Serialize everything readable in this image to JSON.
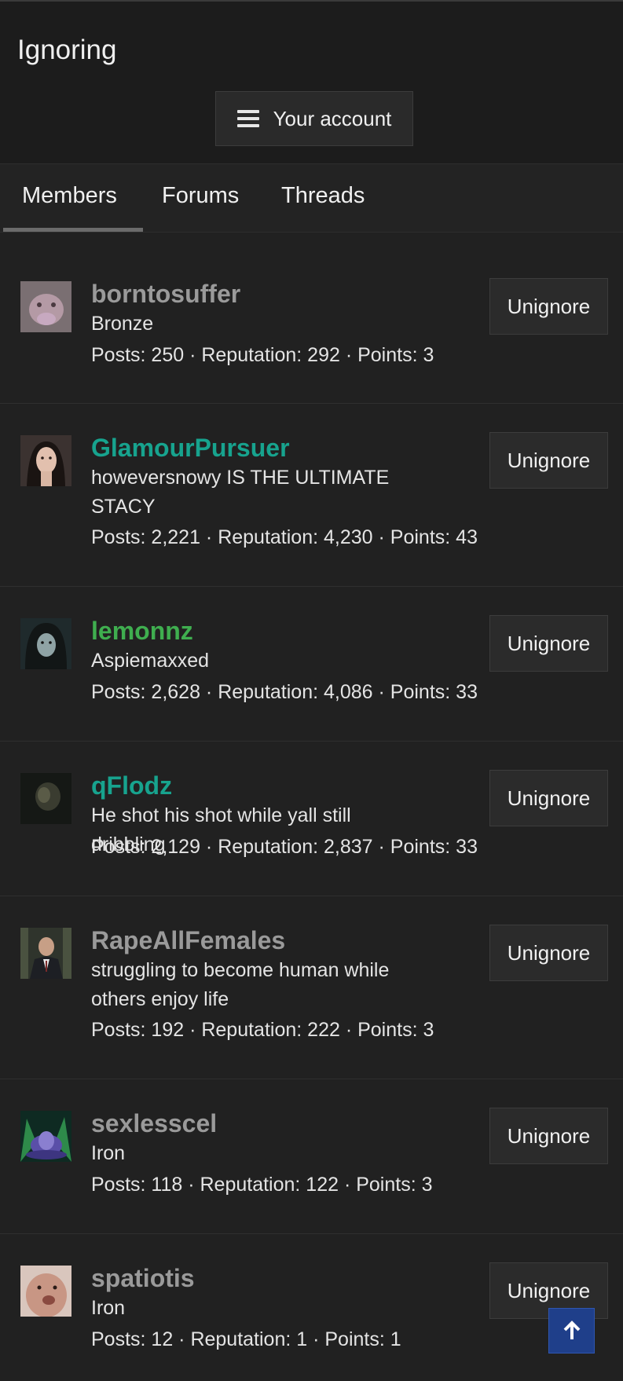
{
  "header": {
    "title": "Ignoring",
    "account_label": "Your account"
  },
  "tabs": [
    {
      "label": "Members"
    },
    {
      "label": "Forums"
    },
    {
      "label": "Threads"
    }
  ],
  "members": [
    {
      "name": "borntosuffer",
      "name_color": "#9a9a9a",
      "title": "Bronze",
      "stats": "Posts: 250 · Reputation: 292 · Points: 3",
      "action": "Unignore"
    },
    {
      "name": "GlamourPursuer",
      "name_color": "#17a38e",
      "title": "howeversnowy IS THE ULTIMATE STACY",
      "stats": "Posts: 2,221 · Reputation: 4,230 · Points: 43",
      "action": "Unignore"
    },
    {
      "name": "lemonnz",
      "name_color": "#3fae4f",
      "title": "Aspiemaxxed",
      "stats": "Posts: 2,628 · Reputation: 4,086 · Points: 33",
      "action": "Unignore"
    },
    {
      "name": "qFlodz",
      "name_color": "#17a38e",
      "title": "He shot his shot while yall still dribbling",
      "stats": "Posts: 2,129 · Reputation: 2,837 · Points: 33",
      "action": "Unignore"
    },
    {
      "name": "RapeAllFemales",
      "name_color": "#9a9a9a",
      "title": "struggling to become human while others enjoy life",
      "stats": "Posts: 192 · Reputation: 222 · Points: 3",
      "action": "Unignore"
    },
    {
      "name": "sexlesscel",
      "name_color": "#9a9a9a",
      "title": "Iron",
      "stats": "Posts: 118 · Reputation: 122 · Points: 3",
      "action": "Unignore"
    },
    {
      "name": "spatiotis",
      "name_color": "#9a9a9a",
      "title": "Iron",
      "stats": "Posts: 12 · Reputation: 1 · Points: 1",
      "action": "Unignore"
    }
  ],
  "icons": {
    "menu": "hamburger-icon",
    "scroll_top": "arrow-up-icon"
  },
  "colors": {
    "background": "#1c1c1c",
    "scroll_top": "#1f3f8a"
  }
}
